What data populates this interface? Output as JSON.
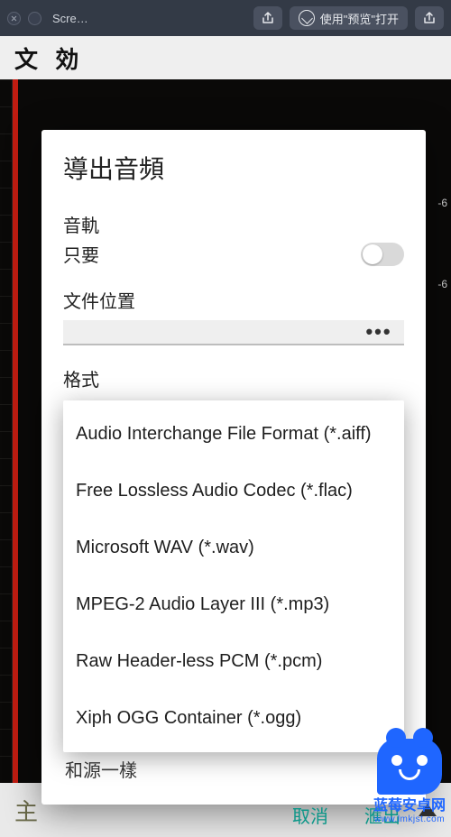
{
  "titlebar": {
    "title": "Scre…",
    "open_with_preview": "使用\"预览\"打开"
  },
  "app_header": "文   効",
  "ruler": {
    "tick1": "-6",
    "tick2": "-6"
  },
  "bottom_bar": {
    "zhu": "主"
  },
  "dialog": {
    "title": "導出音頻",
    "track_label": "音軌",
    "only_toggle_label": "只要",
    "file_location_label": "文件位置",
    "file_location_value": "",
    "format_label": "格式",
    "format_options": [
      "Audio Interchange File Format (*.aiff)",
      "Free Lossless Audio Codec (*.flac)",
      "Microsoft WAV (*.wav)",
      "MPEG-2 Audio Layer III (*.mp3)",
      "Raw Header-less PCM (*.pcm)",
      "Xiph OGG Container (*.ogg)"
    ],
    "same_as_source": "和源一樣",
    "cancel": "取消",
    "export": "滙出"
  },
  "watermark": {
    "name": "蓝莓安卓网",
    "url": "www.lmkjst.com"
  }
}
